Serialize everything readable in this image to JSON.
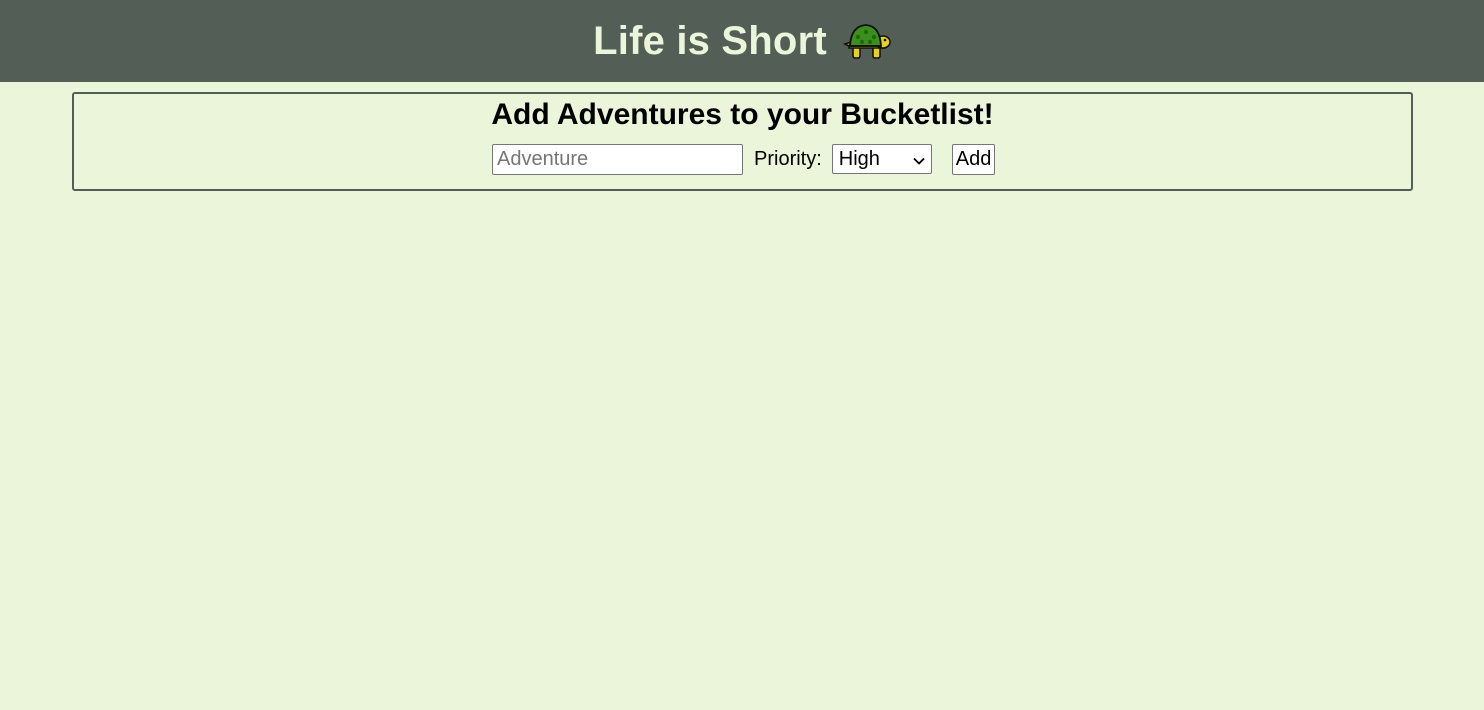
{
  "header": {
    "title": "Life is Short",
    "icon": "turtle-icon"
  },
  "form": {
    "heading": "Add Adventures to your Bucketlist!",
    "adventure_placeholder": "Adventure",
    "adventure_value": "",
    "priority_label": "Priority:",
    "priority_selected": "High",
    "add_label": "Add"
  },
  "colors": {
    "background": "#eaf5da",
    "header_bg": "#535e57",
    "header_text": "#eaf5da"
  }
}
